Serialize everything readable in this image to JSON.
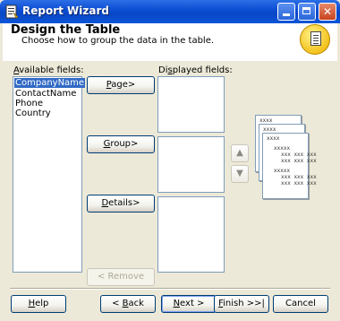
{
  "window": {
    "title": "Report Wizard"
  },
  "header": {
    "title": "Design the Table",
    "subtitle": "Choose how to group the data in the table."
  },
  "available": {
    "label_prefix": "A",
    "label_rest": "vailable fields:",
    "items": [
      "CompanyName",
      "ContactName",
      "Phone",
      "Country"
    ]
  },
  "displayed": {
    "label_prefix": "Di",
    "label_u": "s",
    "label_rest": "played fields:"
  },
  "groups": {
    "page_u": "P",
    "page_rest": "age>",
    "group_u": "G",
    "group_rest": "roup>",
    "details_u": "D",
    "details_rest": "etails>",
    "remove_label": "< Remove"
  },
  "preview": {
    "page1": "xxxx",
    "page2": "xxxx",
    "page3_lines": [
      "xxxx",
      "xxxxx",
      "xxx xxx xxx",
      "xxx xxx xxx",
      "xxxxx",
      "xxx xxx xxx",
      "xxx xxx xxx"
    ]
  },
  "footer": {
    "help_u": "H",
    "help_rest": "elp",
    "back_pre": "< ",
    "back_u": "B",
    "back_rest": "ack",
    "next_u": "N",
    "next_rest": "ext >",
    "finish_u": "F",
    "finish_rest": "inish >>|",
    "cancel": "Cancel"
  }
}
